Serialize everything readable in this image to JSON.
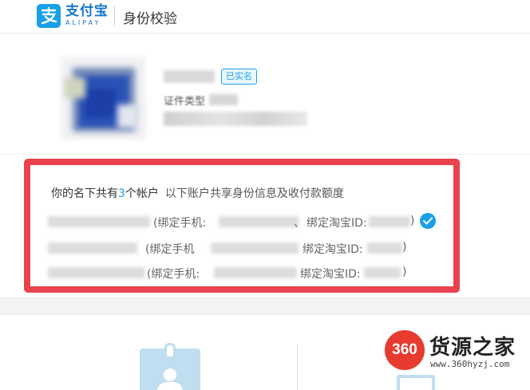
{
  "header": {
    "brand_cn": "支付宝",
    "brand_en": "ALIPAY",
    "page_title": "身份校验"
  },
  "profile": {
    "verified_badge": "已实名",
    "id_type_label": "证件类型"
  },
  "accounts": {
    "summary_prefix": "你的名下共有",
    "count": "3",
    "summary_suffix": "个帐户",
    "note": "以下账户共享身份信息及收付款额度",
    "rows": [
      {
        "phone_label": "(绑定手机:",
        "separator": "、",
        "taobao_label": "绑定淘宝ID:",
        "close": ")",
        "selected": true
      },
      {
        "phone_label": "(绑定手机",
        "separator": "",
        "taobao_label": "绑定淘宝ID:",
        "close": ")",
        "selected": false
      },
      {
        "phone_label": "(绑定手机:",
        "separator": "",
        "taobao_label": "绑定淘宝ID:",
        "close": ")",
        "selected": false
      }
    ]
  },
  "watermark": {
    "logo_text": "360",
    "name": "货源之家",
    "url": "www.360hyzj.com"
  },
  "colors": {
    "accent": "#1aa0e6",
    "highlight_border": "#e8424c",
    "watermark_red": "#e73b2f"
  }
}
